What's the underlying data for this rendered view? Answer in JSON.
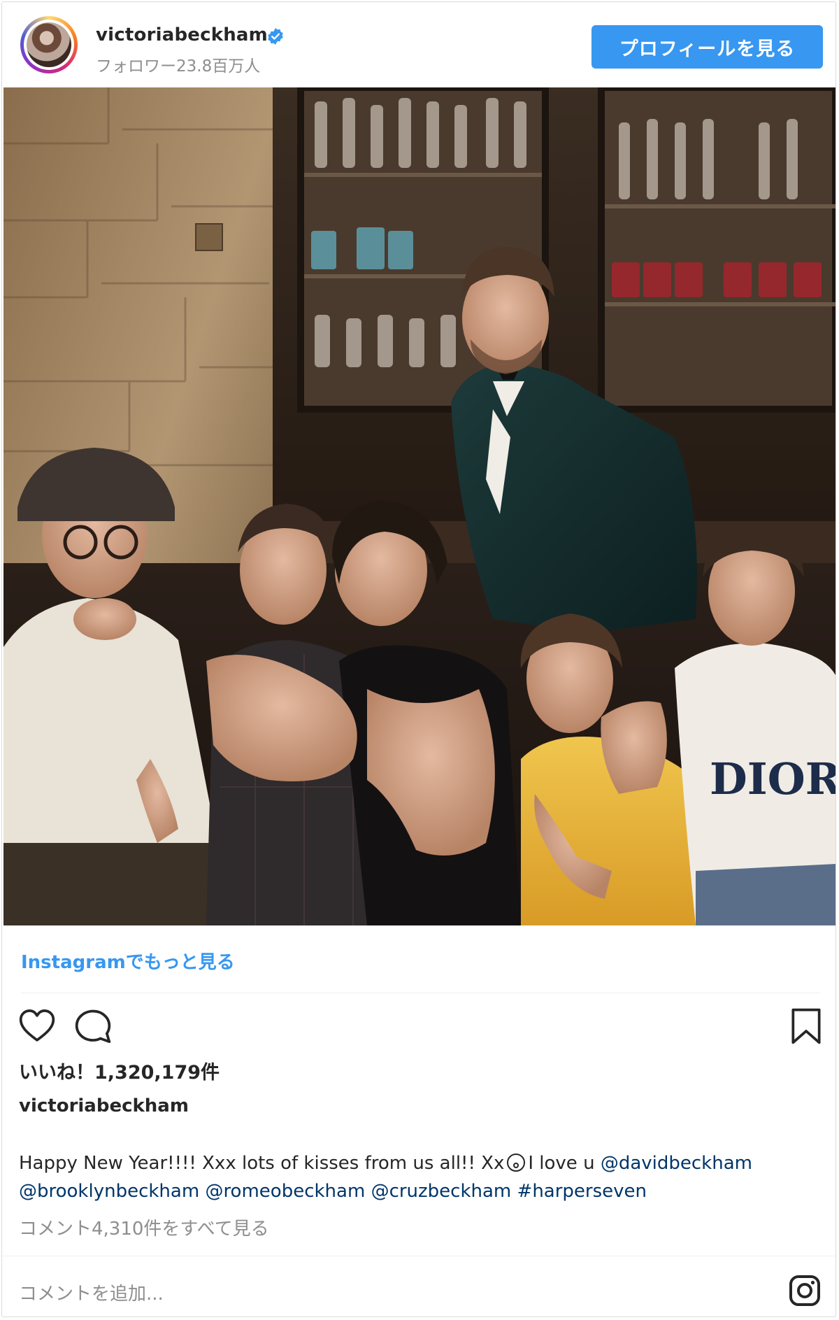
{
  "header": {
    "username": "victoriabeckham",
    "followers": "フォロワー23.8百万人",
    "profile_button": "プロフィールを見る"
  },
  "post": {
    "image_icon": "family-photo",
    "more_link": "Instagramでもっと見る",
    "likes": "いいね！1,320,179件",
    "caption_user": "victoriabeckham",
    "caption_text_1": "Happy New Year!!!! Xxx lots of kisses from us all!! Xx",
    "caption_text_2": "I love u",
    "mentions": {
      "m1": "@davidbeckham",
      "m2": "@brooklynbeckham",
      "m3": "@romeobeckham",
      "m4": "@cruzbeckham",
      "m5": "#harperseven"
    },
    "comments_link": "コメント4,310件をすべて見る",
    "add_comment_placeholder": "コメントを追加..."
  },
  "icons": {
    "verified": "verified-badge-icon",
    "like": "heart-icon",
    "comment": "comment-bubble-icon",
    "save": "bookmark-icon",
    "instagram": "instagram-logo-icon"
  },
  "colors": {
    "accent": "#3897f0",
    "mention": "#003569",
    "muted": "#8e8e8e",
    "text": "#262626"
  }
}
